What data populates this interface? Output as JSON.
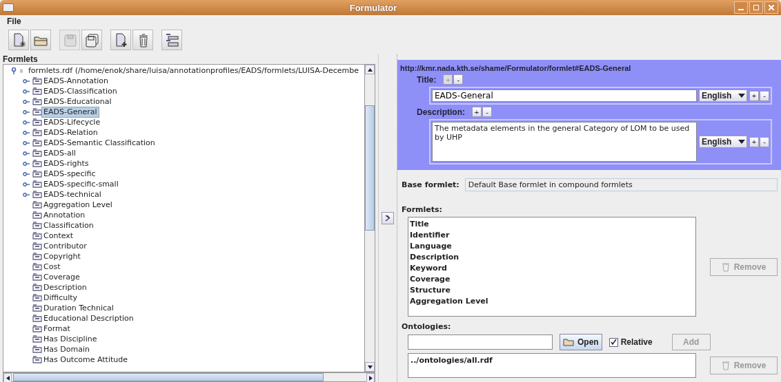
{
  "window": {
    "title": "Formulator"
  },
  "menu": [
    "File"
  ],
  "toolbar": [
    {
      "kind": "new",
      "disabled": false
    },
    {
      "kind": "open",
      "disabled": false
    },
    {
      "kind": "save",
      "disabled": true
    },
    {
      "kind": "saveas",
      "disabled": false
    },
    {
      "kind": "add",
      "disabled": false
    },
    {
      "kind": "delete",
      "disabled": false
    },
    {
      "kind": "layout",
      "disabled": false
    }
  ],
  "tree": {
    "label": "Formlets",
    "root": {
      "label": "formlets.rdf  (/home/enok/share/luisa/annotationprofiles/EADS/formlets/LUISA-Decembe",
      "expanded": true,
      "children": [
        {
          "label": "EADS-Annotation",
          "kind": "group",
          "selected": false
        },
        {
          "label": "EADS-Classification",
          "kind": "group",
          "selected": false
        },
        {
          "label": "EADS-Educational",
          "kind": "group",
          "selected": false
        },
        {
          "label": "EADS-General",
          "kind": "group",
          "selected": true
        },
        {
          "label": "EADS-Lifecycle",
          "kind": "group",
          "selected": false
        },
        {
          "label": "EADS-Relation",
          "kind": "group",
          "selected": false
        },
        {
          "label": "EADS-Semantic Classification",
          "kind": "group",
          "selected": false
        },
        {
          "label": "EADS-all",
          "kind": "group",
          "selected": false
        },
        {
          "label": "EADS-rights",
          "kind": "group",
          "selected": false
        },
        {
          "label": "EADS-specific",
          "kind": "group",
          "selected": false
        },
        {
          "label": "EADS-specific-small",
          "kind": "group",
          "selected": false
        },
        {
          "label": "EADS-technical",
          "kind": "group",
          "selected": false
        },
        {
          "label": "Aggregation Level",
          "kind": "leaf",
          "selected": false
        },
        {
          "label": "Annotation",
          "kind": "leaf",
          "selected": false
        },
        {
          "label": "Classification",
          "kind": "leaf",
          "selected": false
        },
        {
          "label": "Context",
          "kind": "leaf",
          "selected": false
        },
        {
          "label": "Contributor",
          "kind": "leaf",
          "selected": false
        },
        {
          "label": "Copyright",
          "kind": "leaf",
          "selected": false
        },
        {
          "label": "Cost",
          "kind": "leaf",
          "selected": false
        },
        {
          "label": "Coverage",
          "kind": "leaf",
          "selected": false
        },
        {
          "label": "Description",
          "kind": "leaf",
          "selected": false
        },
        {
          "label": "Difficulty",
          "kind": "leaf",
          "selected": false
        },
        {
          "label": "Duration Technical",
          "kind": "leaf",
          "selected": false
        },
        {
          "label": "Educational Description",
          "kind": "leaf",
          "selected": false
        },
        {
          "label": "Format",
          "kind": "leaf",
          "selected": false
        },
        {
          "label": "Has Discipline",
          "kind": "leaf",
          "selected": false
        },
        {
          "label": "Has Domain",
          "kind": "leaf",
          "selected": false
        },
        {
          "label": "Has Outcome Attitude",
          "kind": "leaf",
          "selected": false
        }
      ]
    }
  },
  "editor": {
    "uri": "http://kmr.nada.kth.se/shame/Formulator/formlet#EADS-General",
    "title": {
      "label": "Title:",
      "add": {
        "label": "+",
        "disabled": true
      },
      "remove": "-",
      "value": "EADS-General",
      "language": "English",
      "entry_add": "+",
      "entry_remove": "-"
    },
    "description": {
      "label": "Description:",
      "add": {
        "label": "+",
        "disabled": false
      },
      "remove": "-",
      "value": "The metadata elements in the general Category of LOM to be used by UHP",
      "language": "English",
      "entry_add": "+",
      "entry_remove": "-"
    },
    "base_formlet": {
      "label": "Base formlet:",
      "value": "Default Base formlet in compound formlets"
    },
    "formlets": {
      "label": "Formlets:",
      "items": [
        "Title",
        "Identifier",
        "Language",
        "Description",
        "Keyword",
        "Coverage",
        "Structure",
        "Aggregation Level"
      ],
      "remove": {
        "label": "Remove",
        "disabled": true
      }
    },
    "ontologies": {
      "label": "Ontologies:",
      "open": "Open",
      "relative": {
        "label": "Relative",
        "checked": true
      },
      "add": {
        "label": "Add",
        "disabled": true
      },
      "items": [
        "../ontologies/all.rdf"
      ],
      "remove": {
        "label": "Remove",
        "disabled": true
      }
    }
  }
}
